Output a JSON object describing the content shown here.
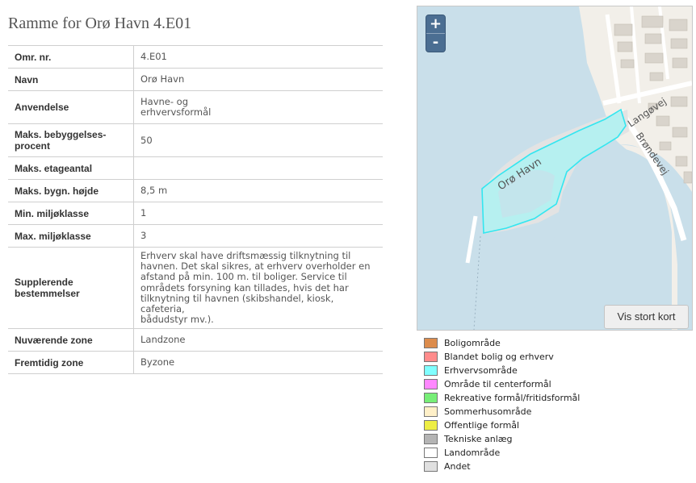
{
  "page": {
    "title": "Ramme for Orø Havn 4.E01"
  },
  "rows": [
    {
      "key": "Omr. nr.",
      "value": "4.E01"
    },
    {
      "key": "Navn",
      "value": "Orø Havn"
    },
    {
      "key": "Anvendelse",
      "value": "Havne- og\nerhvervsformål"
    },
    {
      "key": "Maks. bebyggelses-\nprocent",
      "value": "50"
    },
    {
      "key": "Maks. etageantal",
      "value": ""
    },
    {
      "key": "Maks. bygn. højde",
      "value": "8,5 m"
    },
    {
      "key": "Min. miljøklasse",
      "value": "1"
    },
    {
      "key": "Max. miljøklasse",
      "value": "3"
    },
    {
      "key": "Supplerende\nbestemmelser",
      "value": "Erhverv skal have driftsmæssig tilknytning til\nhavnen. Det skal sikres, at erhverv overholder en\nafstand på min. 100 m. til boliger. Service til\nområdets forsyning kan tillades, hvis det har\ntilknytning til havnen (skibshandel, kiosk, cafeteria,\nbådudstyr mv.)."
    },
    {
      "key": "Nuværende zone",
      "value": "Landzone"
    },
    {
      "key": "Fremtidig zone",
      "value": "Byzone"
    }
  ],
  "map": {
    "zoom_in_label": "+",
    "zoom_out_label": "-",
    "big_map_label": "Vis stort kort",
    "labels": {
      "harbor": "Orø Havn",
      "road1": "Langøvej",
      "road2": "Brøndevej"
    },
    "colors": {
      "water": "#c9dfea",
      "land": "#f2efe9",
      "area": "#7fffff"
    }
  },
  "legend": [
    {
      "label": "Boligområde",
      "color": "#dc8c4c"
    },
    {
      "label": "Blandet bolig og erhverv",
      "color": "#ff8c8c"
    },
    {
      "label": "Erhvervsområde",
      "color": "#80ffff"
    },
    {
      "label": "Område til centerformål",
      "color": "#ff88ff"
    },
    {
      "label": "Rekreative formål/fritidsformål",
      "color": "#77ee77"
    },
    {
      "label": "Sommerhusområde",
      "color": "#fff0c8"
    },
    {
      "label": "Offentlige formål",
      "color": "#eeee44"
    },
    {
      "label": "Tekniske anlæg",
      "color": "#b4b4b4"
    },
    {
      "label": "Landområde",
      "color": "#ffffff"
    },
    {
      "label": "Andet",
      "color": "#e0e0e0"
    }
  ]
}
